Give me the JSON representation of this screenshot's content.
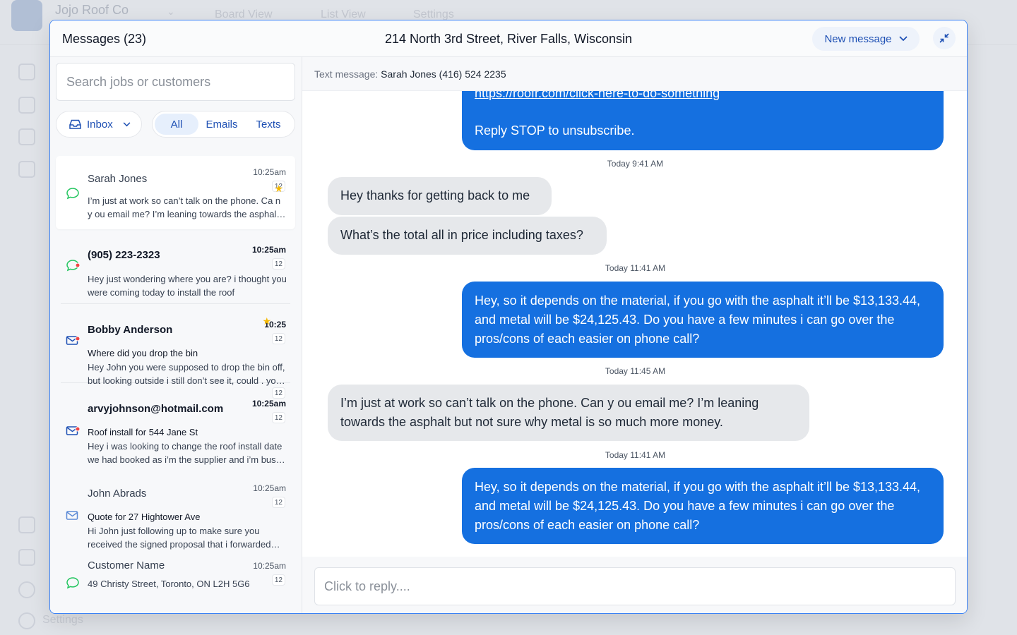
{
  "background": {
    "company": "Jojo Roof Co",
    "tabs": [
      "Board View",
      "List View",
      "Settings"
    ],
    "sidebar_settings": "Settings"
  },
  "modal": {
    "title": "Messages (23)",
    "address": "214 North 3rd Street, River Falls, Wisconsin",
    "new_message_label": "New message"
  },
  "left": {
    "search_placeholder": "Search jobs or customers",
    "inbox_label": "Inbox",
    "filters": {
      "all": "All",
      "emails": "Emails",
      "texts": "Texts"
    },
    "conversations": [
      {
        "name": "Sarah Jones",
        "time": "10:25am",
        "badge": "12",
        "subject": "",
        "preview": "I’m just at work so can’t talk on the phone. Ca n y ou email me? I’m leaning towards the asphalt but not sure why metal is so much more money.",
        "icon": "chat-bubble-icon"
      },
      {
        "name": "(905) 223-2323",
        "time": "10:25am",
        "badge": "12",
        "subject": "",
        "preview": "Hey just wondering where you are? i thought you were coming today to install the roof",
        "icon": "chat-bubble-unread-icon"
      },
      {
        "name": "Bobby Anderson",
        "time": "10:25",
        "badge": "12",
        "subject": "Where did you drop the bin",
        "preview": "Hey John you were supposed to drop the bin off, but looking outside i still don’t see it, could . you let me know when it will arrive",
        "icon": "mail-unread-icon"
      },
      {
        "name": "arvyjohnson@hotmail.com",
        "time": "10:25am",
        "badge": "12",
        "badge_top": "12",
        "subject": "Roof install for 544 Jane St",
        "preview": "Hey i was looking to change the roof install date we had booked as i’m the supplier and i’m busy that day",
        "icon": "mail-unread-icon"
      },
      {
        "name": "John Abrads",
        "time": "10:25am",
        "badge": "12",
        "subject": "Quote for 27 Hightower Ave",
        "preview": "Hi John just following up to make sure you received the signed proposal that i forwarded over to you",
        "icon": "mail-icon"
      },
      {
        "name": "Customer Name",
        "time": "10:25am",
        "badge": "12",
        "subject": "",
        "preview": "49 Christy Street, Toronto, ON L2H 5G6",
        "icon": "chat-bubble-icon"
      }
    ]
  },
  "thread": {
    "header_prefix": "Text message:",
    "header_contact": "Sarah Jones (416) 524 2235",
    "link_text": "https://roofr.com/click-here-to-do-something",
    "unsubscribe": "Reply STOP to unsubscribe.",
    "stamp1": "Today 9:41 AM",
    "in1": "Hey thanks for getting back to me",
    "in2": "What’s the total all in price including taxes?",
    "stamp2": "Today 11:41 AM",
    "out1": "Hey, so it depends on the material, if you go with the asphalt it’ll be $13,133.44, and metal will be $24,125.43. Do you have a few minutes i can go over the pros/cons of each easier on phone call?",
    "stamp3": "Today 11:45 AM",
    "in3": "I’m just at work so can’t talk on the phone. Can y ou email me? I’m leaning towards the asphalt but not sure why metal is so much more money.",
    "stamp4": "Today 11:41 AM",
    "out2": "Hey, so it depends on the material, if you go with the asphalt it’ll be $13,133.44, and metal will be $24,125.43. Do you have a few minutes i can go over the pros/cons of each easier on phone call?",
    "reply_placeholder": "Click to reply...."
  },
  "colors": {
    "accent": "#1570e0",
    "link_blue": "#1e50b4",
    "modal_border": "#3b82f6"
  }
}
